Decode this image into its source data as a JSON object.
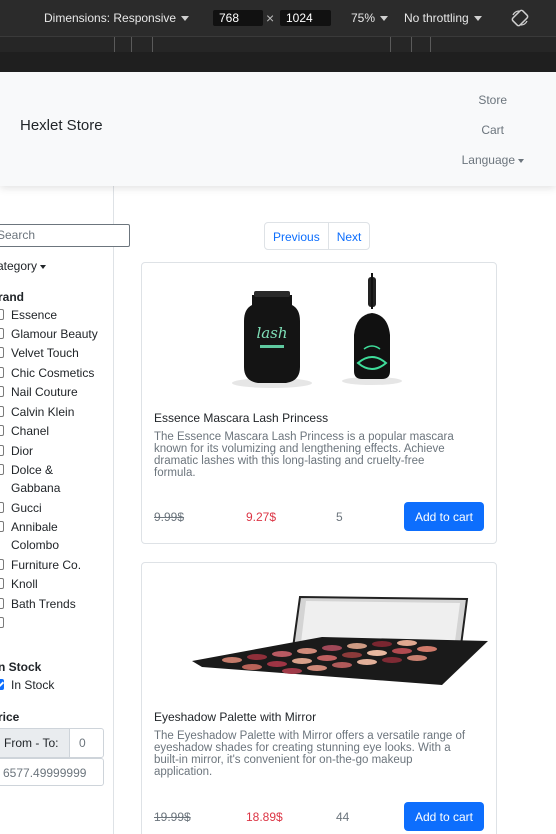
{
  "devtools": {
    "dimensions_label": "Dimensions: Responsive",
    "width": "768",
    "times": "×",
    "height": "1024",
    "zoom": "75%",
    "throttle": "No throttling",
    "rotate_icon": "rotate-icon"
  },
  "navbar": {
    "brand": "Hexlet Store",
    "store": "Store",
    "cart": "Cart",
    "language": "Language"
  },
  "sidebar": {
    "search_placeholder": "Search",
    "category": "ategory",
    "brand_title": "rand",
    "brands": [
      "Essence",
      "Glamour Beauty",
      "Velvet Touch",
      "Chic Cosmetics",
      "Nail Couture",
      "Calvin Klein",
      "Chanel",
      "Dior",
      "Dolce &",
      "Gabbana",
      "Gucci",
      "Annibale",
      "Colombo",
      "Furniture Co.",
      "Knoll",
      "Bath Trends"
    ],
    "stock_title": "n Stock",
    "in_stock": "In Stock",
    "price_title": "rice",
    "price_from_to": "From - To:",
    "price_min": "0",
    "price_max": "6577.49999999"
  },
  "pagination": {
    "previous": "Previous",
    "next": "Next"
  },
  "products": [
    {
      "title": "Essence Mascara Lash Princess",
      "description_lines": [
        "The Essence Mascara Lash Princess is a popular mascara",
        "known for its volumizing and lengthening effects. Achieve",
        "dramatic lashes with this long-lasting and cruelty-free",
        "formula."
      ],
      "old_price": "9.99$",
      "new_price": "9.27$",
      "quantity": "5",
      "button": "Add to cart"
    },
    {
      "title": "Eyeshadow Palette with Mirror",
      "description_lines": [
        "The Eyeshadow Palette with Mirror offers a versatile range of",
        "eyeshadow shades for creating stunning eye looks. With a",
        "built-in mirror, it's convenient for on-the-go makeup",
        "application."
      ],
      "old_price": "19.99$",
      "new_price": "18.89$",
      "quantity": "44",
      "button": "Add to cart"
    }
  ],
  "colors": {
    "primary": "#0d6efd",
    "danger": "#dc3545",
    "muted": "#6c757d"
  }
}
